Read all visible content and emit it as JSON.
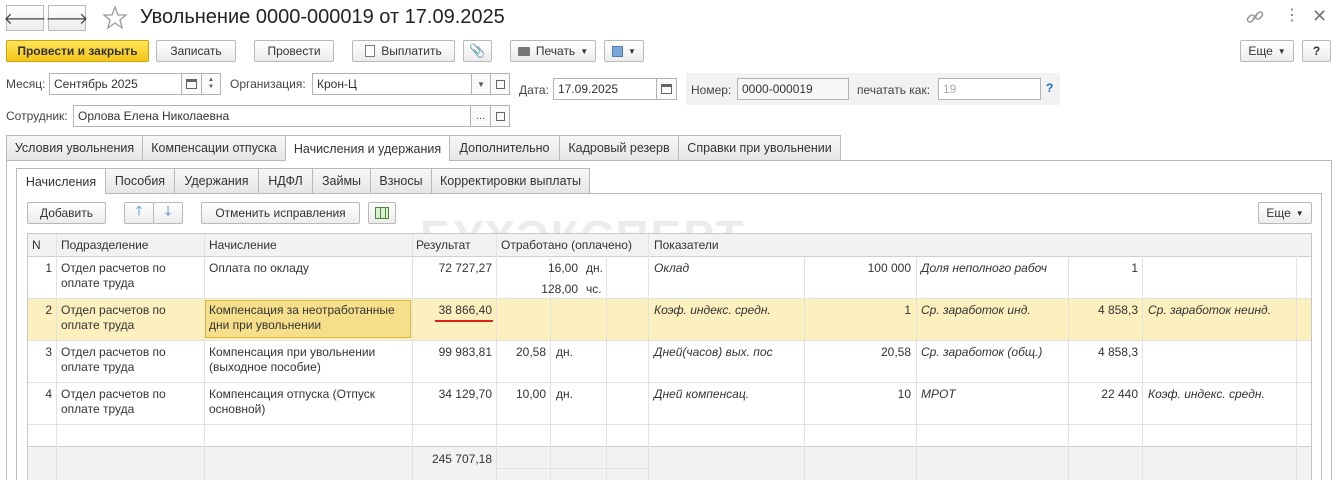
{
  "title": "Увольнение 0000-000019 от 17.09.2025",
  "nav": {
    "back": "🡐",
    "forward": "🡒"
  },
  "toolbar": {
    "post_close": "Провести и закрыть",
    "save": "Записать",
    "post": "Провести",
    "pay": "Выплатить",
    "print": "Печать",
    "more": "Еще",
    "help": "?"
  },
  "form": {
    "month_label": "Месяц:",
    "month_value": "Сентябрь 2025",
    "org_label": "Организация:",
    "org_value": "Крон-Ц",
    "date_label": "Дата:",
    "date_value": "17.09.2025",
    "number_label": "Номер:",
    "number_value": "0000-000019",
    "print_as_label": "печатать как:",
    "print_as_value": "19",
    "print_as_help": "?",
    "employee_label": "Сотрудник:",
    "employee_value": "Орлова Елена Николаевна",
    "ellipsis": "..."
  },
  "tabs": [
    "Условия увольнения",
    "Компенсации отпуска",
    "Начисления и удержания",
    "Дополнительно",
    "Кадровый резерв",
    "Справки при увольнении"
  ],
  "subtabs": [
    "Начисления",
    "Пособия",
    "Удержания",
    "НДФЛ",
    "Займы",
    "Взносы",
    "Корректировки выплаты"
  ],
  "table_toolbar": {
    "add": "Добавить",
    "cancel_corrections": "Отменить исправления",
    "more": "Еще"
  },
  "watermark": "БУХЭКСПЕРТ",
  "columns": [
    "N",
    "Подразделение",
    "Начисление",
    "Результат",
    "Отработано (оплачено)",
    "Показатели"
  ],
  "rows": [
    {
      "n": "1",
      "dept": [
        "Отдел расчетов по",
        "оплате труда"
      ],
      "accrual": [
        "Оплата по окладу"
      ],
      "result": "72 727,27",
      "worked": [
        [
          "16,00",
          "дн."
        ],
        [
          "128,00",
          "чс."
        ]
      ],
      "ind1_name": "Оклад",
      "ind1_val": "100 000",
      "ind2_name": "Доля неполного рабоч",
      "ind2_val": "1",
      "ind3_name": ""
    },
    {
      "n": "2",
      "dept": [
        "Отдел расчетов по",
        "оплате труда"
      ],
      "accrual": [
        "Компенсация за неотработанные",
        "дни при увольнении"
      ],
      "result": "38 866,40",
      "worked": [],
      "ind1_name": "Коэф. индекс. средн.",
      "ind1_val": "1",
      "ind2_name": "Ср. заработок инд.",
      "ind2_val": "4 858,3",
      "ind3_name": "Ср. заработок неинд."
    },
    {
      "n": "3",
      "dept": [
        "Отдел расчетов по",
        "оплате труда"
      ],
      "accrual": [
        "Компенсация при увольнении",
        "(выходное пособие)"
      ],
      "result": "99 983,81",
      "worked": [
        [
          "20,58",
          "дн."
        ]
      ],
      "ind1_name": "Дней(часов) вых. пос",
      "ind1_val": "20,58",
      "ind2_name": "Ср. заработок (общ.)",
      "ind2_val": "4 858,3",
      "ind3_name": ""
    },
    {
      "n": "4",
      "dept": [
        "Отдел расчетов по",
        "оплате труда"
      ],
      "accrual": [
        "Компенсация отпуска (Отпуск",
        "основной)"
      ],
      "result": "34 129,70",
      "worked": [
        [
          "10,00",
          "дн."
        ]
      ],
      "ind1_name": "Дней компенсац.",
      "ind1_val": "10",
      "ind2_name": "МРОТ",
      "ind2_val": "22 440",
      "ind3_name": "Коэф. индекс. средн."
    }
  ],
  "total": "245 707,18",
  "colors": {
    "accent_yellow": "#f4c516",
    "selected_row": "#fbf0be",
    "underline": "#e0201b",
    "link_blue": "#1a6fc9"
  }
}
